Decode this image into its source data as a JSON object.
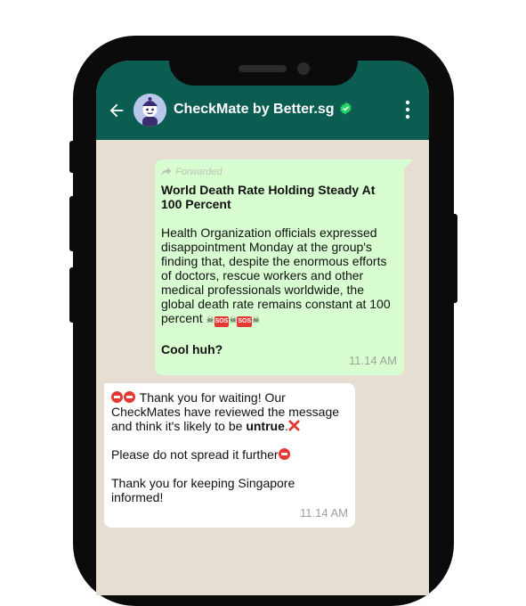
{
  "header": {
    "title": "CheckMate by Better.sg"
  },
  "messages": {
    "outgoing": {
      "forwarded_label": "Forwarded",
      "headline": "World Death Rate Holding Steady At 100 Percent",
      "body": "Health Organization officials expressed disappointment Monday at the group's finding that, despite the enormous efforts of doctors, rescue workers and other medical professionals worldwide, the global death rate remains constant at 100 percent ",
      "emoji_sequence": [
        "☠",
        "SOS",
        "☠",
        "SOS",
        "☠"
      ],
      "closing": "Cool huh?",
      "time": "11.14 AM"
    },
    "incoming": {
      "line1_text": " Thank you for waiting! Our CheckMates have reviewed the message and think it's likely to be ",
      "line1_bold": "untrue",
      "line1_end": ".",
      "line2": "Please do not spread it further",
      "line3": "Thank you for keeping Singapore informed!",
      "time": "11.14 AM"
    }
  },
  "colors": {
    "header": "#0b5d52",
    "chat_background": "#e6ddd3",
    "outgoing_bubble": "#d8fdd0",
    "incoming_bubble": "#ffffff",
    "verified_badge": "#25d366"
  },
  "icons": [
    "back-arrow-icon",
    "bot-avatar",
    "verified-badge-icon",
    "more-vert-icon",
    "forward-icon",
    "skull-icon",
    "sos-icon",
    "no-entry-icon",
    "cross-mark-icon"
  ]
}
